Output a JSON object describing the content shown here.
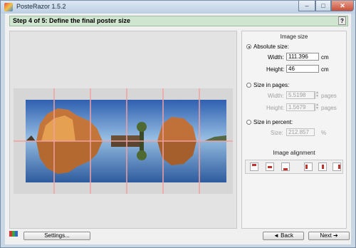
{
  "window": {
    "title": "PosteRazor 1.5.2",
    "min_glyph": "–",
    "max_glyph": "□",
    "close_glyph": "✕"
  },
  "step": {
    "title": "Step 4 of 5: Define the final poster size",
    "help_label": "?"
  },
  "size_panel": {
    "header": "Image size",
    "absolute": {
      "label": "Absolute size:",
      "selected": true,
      "width_label": "Width:",
      "width_value": "111.396",
      "width_unit": "cm",
      "height_label": "Height:",
      "height_value": "46",
      "height_unit": "cm"
    },
    "pages": {
      "label": "Size in pages:",
      "selected": false,
      "width_label": "Width:",
      "width_value": "5.5198",
      "width_unit": "pages",
      "height_label": "Height:",
      "height_value": "1.5679",
      "height_unit": "pages"
    },
    "percent": {
      "label": "Size in percent:",
      "selected": false,
      "size_label": "Size:",
      "size_value": "212.857",
      "size_unit": "%"
    }
  },
  "alignment": {
    "header": "Image alignment",
    "buttons": [
      "top",
      "center",
      "bottom",
      "left",
      "middle",
      "right"
    ]
  },
  "bottom": {
    "settings_label": "Settings...",
    "back_label": "◄ Back",
    "next_label": "Next ➔"
  },
  "colors": {
    "step_bg": "#cfe5cf",
    "grid_line": "#f0a0a0",
    "window_bg": "#c9d6e4"
  }
}
